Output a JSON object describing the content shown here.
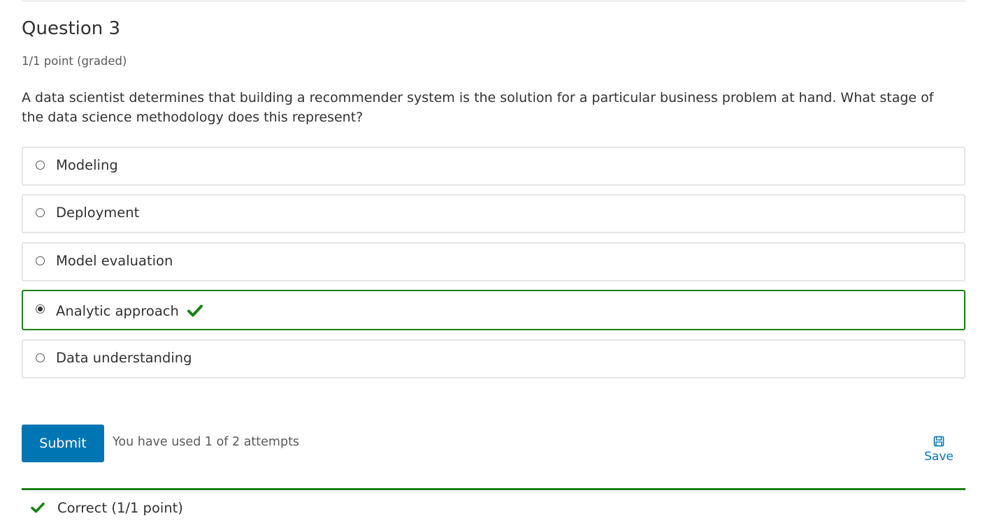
{
  "question": {
    "title": "Question 3",
    "points": "1/1 point (graded)",
    "prompt": "A data scientist determines that building a recommender system is the solution for a particular business problem at hand. What stage of the data science methodology does this represent?"
  },
  "choices": [
    {
      "label": "Modeling",
      "selected": false,
      "correct": false
    },
    {
      "label": "Deployment",
      "selected": false,
      "correct": false
    },
    {
      "label": "Model evaluation",
      "selected": false,
      "correct": false
    },
    {
      "label": "Analytic approach",
      "selected": true,
      "correct": true
    },
    {
      "label": "Data understanding",
      "selected": false,
      "correct": false
    }
  ],
  "actions": {
    "submit_label": "Submit",
    "attempts_text": "You have used 1 of 2 attempts",
    "save_label": "Save"
  },
  "result": {
    "text": "Correct (1/1 point)",
    "icon": "checkmark-icon"
  },
  "colors": {
    "accent": "#0075b4",
    "correct": "#178112",
    "text": "#313131",
    "muted": "#5a5a5a",
    "border": "#e6e6e6"
  }
}
